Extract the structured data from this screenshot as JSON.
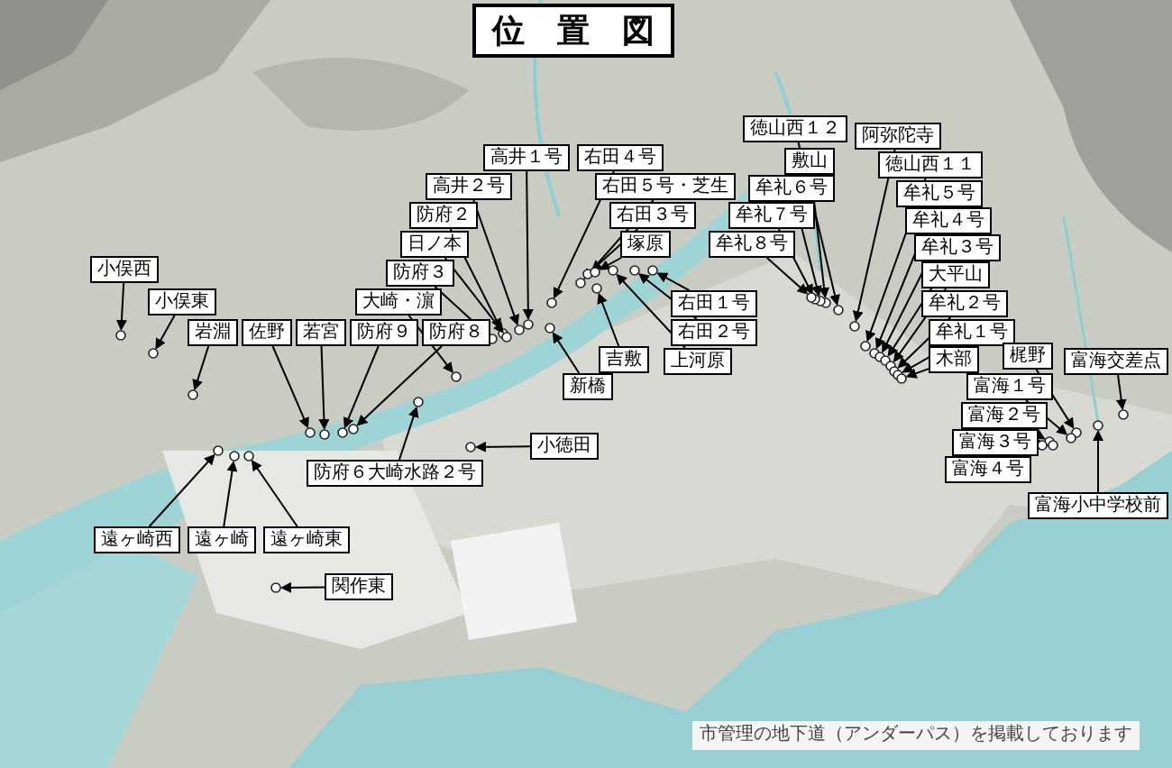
{
  "title": "位　置　図",
  "locations": [
    {
      "name": "徳山西１２"
    },
    {
      "name": "阿弥陀寺"
    },
    {
      "name": "高井１号"
    },
    {
      "name": "右田４号"
    },
    {
      "name": "敷山"
    },
    {
      "name": "徳山西１１"
    },
    {
      "name": "高井２号"
    },
    {
      "name": "右田５号・芝生"
    },
    {
      "name": "牟礼６号"
    },
    {
      "name": "牟礼５号"
    },
    {
      "name": "防府２"
    },
    {
      "name": "右田３号"
    },
    {
      "name": "牟礼７号"
    },
    {
      "name": "牟礼４号"
    },
    {
      "name": "日ノ本"
    },
    {
      "name": "塚原"
    },
    {
      "name": "牟礼８号"
    },
    {
      "name": "牟礼３号"
    },
    {
      "name": "小俣西"
    },
    {
      "name": "防府３"
    },
    {
      "name": "大平山"
    },
    {
      "name": "小俣東"
    },
    {
      "name": "大崎・濵"
    },
    {
      "name": "右田１号"
    },
    {
      "name": "牟礼２号"
    },
    {
      "name": "岩淵"
    },
    {
      "name": "佐野"
    },
    {
      "name": "若宮"
    },
    {
      "name": "防府９"
    },
    {
      "name": "防府８"
    },
    {
      "name": "右田２号"
    },
    {
      "name": "牟礼１号"
    },
    {
      "name": "吉敷"
    },
    {
      "name": "上河原"
    },
    {
      "name": "木部"
    },
    {
      "name": "梶野"
    },
    {
      "name": "富海交差点"
    },
    {
      "name": "新橋"
    },
    {
      "name": "富海１号"
    },
    {
      "name": "富海２号"
    },
    {
      "name": "小徳田"
    },
    {
      "name": "富海３号"
    },
    {
      "name": "防府６大崎水路２号"
    },
    {
      "name": "富海４号"
    },
    {
      "name": "富海小中学校前"
    },
    {
      "name": "遠ヶ崎西"
    },
    {
      "name": "遠ヶ崎"
    },
    {
      "name": "遠ヶ崎東"
    },
    {
      "name": "関作東"
    }
  ],
  "note": "市管理の地下道（アンダーパス）を掲載しております"
}
